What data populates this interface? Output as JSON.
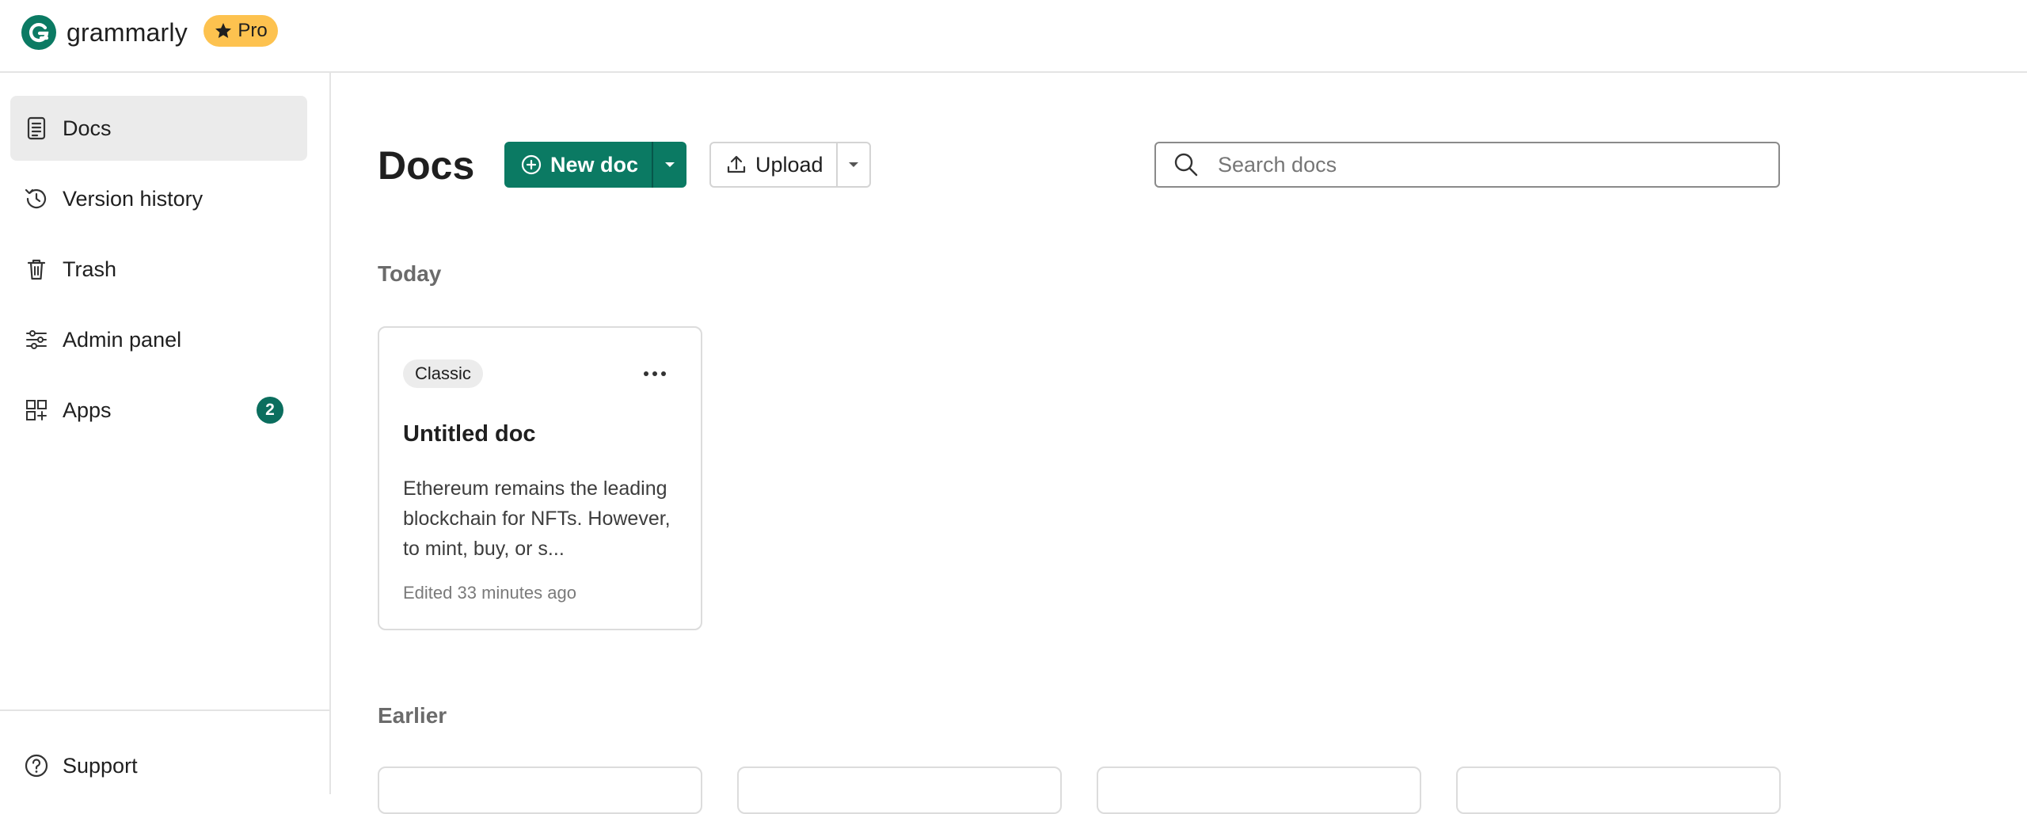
{
  "header": {
    "logo_text": "grammarly",
    "pro_label": "Pro",
    "brand_color": "#0b7a63",
    "pro_color": "#fdc24f"
  },
  "sidebar": {
    "items": [
      {
        "label": "Docs",
        "icon": "document-icon",
        "active": true
      },
      {
        "label": "Version history",
        "icon": "history-icon",
        "active": false
      },
      {
        "label": "Trash",
        "icon": "trash-icon",
        "active": false
      },
      {
        "label": "Admin panel",
        "icon": "sliders-icon",
        "active": false
      },
      {
        "label": "Apps",
        "icon": "apps-grid-icon",
        "active": false,
        "badge": "2"
      }
    ],
    "support_label": "Support"
  },
  "main": {
    "title": "Docs",
    "new_doc_label": "New doc",
    "upload_label": "Upload",
    "search_placeholder": "Search docs",
    "sections": {
      "today": "Today",
      "earlier": "Earlier"
    },
    "today_docs": [
      {
        "tag": "Classic",
        "title": "Untitled doc",
        "excerpt": "Ethereum remains the leading blockchain for NFTs. However, to mint, buy, or s...",
        "meta": "Edited 33 minutes ago"
      }
    ]
  }
}
